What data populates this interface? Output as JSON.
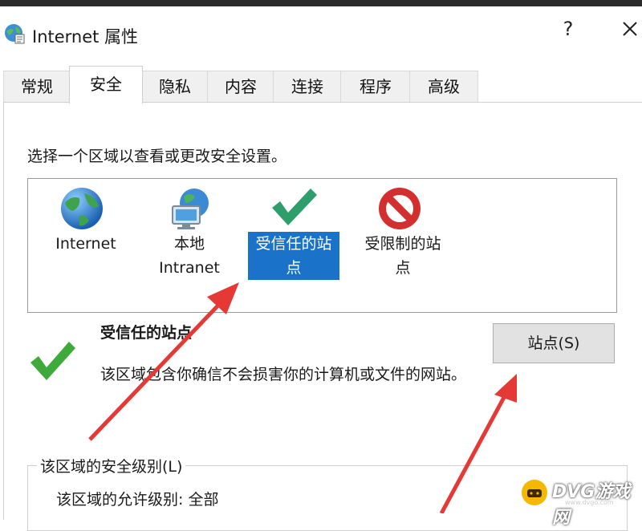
{
  "window": {
    "title": "Internet 属性",
    "help_glyph": "?"
  },
  "tabs": [
    {
      "label": "常规",
      "active": false
    },
    {
      "label": "安全",
      "active": true
    },
    {
      "label": "隐私",
      "active": false
    },
    {
      "label": "内容",
      "active": false
    },
    {
      "label": "连接",
      "active": false
    },
    {
      "label": "程序",
      "active": false
    },
    {
      "label": "高级",
      "active": false
    }
  ],
  "security": {
    "instruction": "选择一个区域以查看或更改安全设置。",
    "zones": [
      {
        "line1": "Internet",
        "line2": "",
        "icon": "globe-icon",
        "selected": false
      },
      {
        "line1": "本地",
        "line2": "Intranet",
        "icon": "intranet-icon",
        "selected": false
      },
      {
        "line1": "受信任的站",
        "line2": "点",
        "icon": "checkmark-icon",
        "selected": true
      },
      {
        "line1": "受限制的站",
        "line2": "点",
        "icon": "restricted-icon",
        "selected": false
      }
    ],
    "selected_zone": {
      "name": "受信任的站点",
      "description": "该区域包含你确信不会损害你的计算机或文件的网站。"
    },
    "sites_button": "站点(S)",
    "level_group": {
      "legend": "该区域的安全级别(L)",
      "allowed_level": "该区域的允许级别: 全部"
    }
  },
  "watermark": {
    "brand": "DVG游戏网",
    "sub": "www.dvgo.com"
  },
  "colors": {
    "selection": "#1a73c9",
    "annotation_arrow": "#e53935",
    "check_green": "#2e9e6b"
  }
}
